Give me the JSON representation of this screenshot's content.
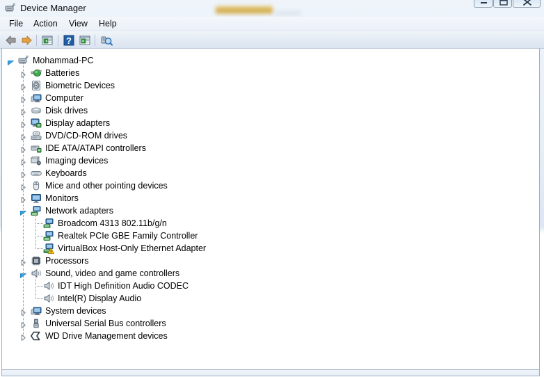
{
  "window": {
    "title": "Device Manager",
    "title_icon": "device-manager-icon",
    "controls": {
      "minimize": "Minimize",
      "maximize": "Maximize",
      "close": "Close"
    }
  },
  "menubar": {
    "items": [
      {
        "label": "File",
        "name": "menu-file"
      },
      {
        "label": "Action",
        "name": "menu-action"
      },
      {
        "label": "View",
        "name": "menu-view"
      },
      {
        "label": "Help",
        "name": "menu-help"
      }
    ]
  },
  "toolbar": {
    "buttons": [
      {
        "name": "back-button",
        "icon": "arrow-left-icon",
        "tooltip": "Back"
      },
      {
        "name": "forward-button",
        "icon": "arrow-right-icon",
        "tooltip": "Forward"
      },
      {
        "name": "properties-button",
        "icon": "properties-icon",
        "tooltip": "Properties"
      },
      {
        "name": "help-button",
        "icon": "question-mark-icon",
        "tooltip": "Help"
      },
      {
        "name": "update-driver-button",
        "icon": "update-driver-icon",
        "tooltip": "Update Driver Software"
      },
      {
        "name": "scan-hardware-button",
        "icon": "scan-hardware-icon",
        "tooltip": "Scan for hardware changes"
      }
    ]
  },
  "tree": {
    "nodes": [
      {
        "label": "Mohammad-PC",
        "level": 0,
        "state": "expanded",
        "icon": "computer-root-icon"
      },
      {
        "label": "Batteries",
        "level": 1,
        "state": "collapsed",
        "icon": "battery-icon"
      },
      {
        "label": "Biometric Devices",
        "level": 1,
        "state": "collapsed",
        "icon": "fingerprint-icon"
      },
      {
        "label": "Computer",
        "level": 1,
        "state": "collapsed",
        "icon": "computer-icon"
      },
      {
        "label": "Disk drives",
        "level": 1,
        "state": "collapsed",
        "icon": "disk-drive-icon"
      },
      {
        "label": "Display adapters",
        "level": 1,
        "state": "collapsed",
        "icon": "display-adapter-icon"
      },
      {
        "label": "DVD/CD-ROM drives",
        "level": 1,
        "state": "collapsed",
        "icon": "dvd-drive-icon"
      },
      {
        "label": "IDE ATA/ATAPI controllers",
        "level": 1,
        "state": "collapsed",
        "icon": "ide-controller-icon"
      },
      {
        "label": "Imaging devices",
        "level": 1,
        "state": "collapsed",
        "icon": "camera-icon"
      },
      {
        "label": "Keyboards",
        "level": 1,
        "state": "collapsed",
        "icon": "keyboard-icon"
      },
      {
        "label": "Mice and other pointing devices",
        "level": 1,
        "state": "collapsed",
        "icon": "mouse-icon"
      },
      {
        "label": "Monitors",
        "level": 1,
        "state": "collapsed",
        "icon": "monitor-icon"
      },
      {
        "label": "Network adapters",
        "level": 1,
        "state": "expanded",
        "icon": "network-adapter-icon"
      },
      {
        "label": "Broadcom 4313 802.11b/g/n",
        "level": 2,
        "state": "leaf",
        "icon": "network-adapter-icon"
      },
      {
        "label": "Realtek PCIe GBE Family Controller",
        "level": 2,
        "state": "leaf",
        "icon": "network-adapter-icon"
      },
      {
        "label": "VirtualBox Host-Only Ethernet Adapter",
        "level": 2,
        "state": "leaf",
        "icon": "network-adapter-warning-icon"
      },
      {
        "label": "Processors",
        "level": 1,
        "state": "collapsed",
        "icon": "processor-icon"
      },
      {
        "label": "Sound, video and game controllers",
        "level": 1,
        "state": "expanded",
        "icon": "speaker-icon"
      },
      {
        "label": "IDT High Definition Audio CODEC",
        "level": 2,
        "state": "leaf",
        "icon": "speaker-icon"
      },
      {
        "label": "Intel(R) Display Audio",
        "level": 2,
        "state": "leaf",
        "icon": "speaker-icon"
      },
      {
        "label": "System devices",
        "level": 1,
        "state": "collapsed",
        "icon": "computer-icon"
      },
      {
        "label": "Universal Serial Bus controllers",
        "level": 1,
        "state": "collapsed",
        "icon": "usb-icon"
      },
      {
        "label": "WD Drive Management devices",
        "level": 1,
        "state": "collapsed",
        "icon": "wd-drive-icon"
      }
    ]
  },
  "statusbar": {
    "text": ""
  },
  "colors": {
    "accent": "#2b6fb5",
    "warning": "#ffcc00",
    "tree_text": "#000000",
    "panel_bg": "#ffffff"
  }
}
